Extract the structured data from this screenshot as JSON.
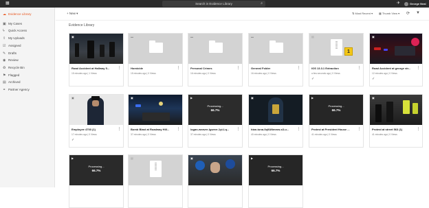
{
  "topbar": {
    "search_placeholder": "Search in Evidence Library",
    "user_name": "George Neal"
  },
  "sidebar": {
    "items": [
      {
        "label": "Evidence Library",
        "icon": "cloud-icon",
        "active": true
      },
      {
        "label": "My Cases",
        "icon": "briefcase-icon"
      },
      {
        "label": "Quick Access",
        "icon": "lightning-icon"
      },
      {
        "label": "My Uploads",
        "icon": "upload-icon"
      },
      {
        "label": "Assigned",
        "icon": "assigned-icon"
      },
      {
        "label": "Drafts",
        "icon": "draft-icon"
      },
      {
        "label": "Review",
        "icon": "review-icon"
      },
      {
        "label": "Recycle Bin",
        "icon": "trash-icon"
      },
      {
        "label": "Flagged",
        "icon": "flag-icon"
      },
      {
        "label": "Archived",
        "icon": "archive-icon"
      },
      {
        "label": "Partner Agency",
        "icon": "link-icon"
      }
    ]
  },
  "header": {
    "new_label": "New",
    "sort_label": "Most Recent",
    "view_label": "Thumb View"
  },
  "page_title": "Evidence Library",
  "cards": [
    {
      "name": "Road Accident at Hallway 5...",
      "meta": "15 minutes ago  |  1 Views",
      "type": "image"
    },
    {
      "name": "Homicide",
      "meta": "15 minutes ago  |  0 Views",
      "type": "folder"
    },
    {
      "name": "Personal Crimes",
      "meta": "16 minutes ago  |  0 Views",
      "type": "folder"
    },
    {
      "name": "General Folder",
      "meta": "16 minutes ago  |  0 Views",
      "type": "folder"
    },
    {
      "name": "IOS 13.3.1 Extraction",
      "meta": "a few seconds ago  |  0 Views",
      "type": "zip",
      "badge": "1",
      "check": true
    },
    {
      "name": "Road Accident at george str...",
      "meta": "12 minutes ago  |  0 Views",
      "type": "image",
      "check": true
    },
    {
      "name": "Employee 4703 (1)",
      "meta": "17 minutes ago  |  0 Views",
      "type": "image",
      "check": true
    },
    {
      "name": "Bomb Blast at Roadway Hill...",
      "meta": "37 minutes ago  |  0 Views",
      "type": "image"
    },
    {
      "name": "logan-weaver-lgwevr-1yt-Lq...",
      "meta": "37 minutes ago  |  0 Views",
      "type": "processing",
      "progress": "66.7%"
    },
    {
      "name": "hian-tuna-0q9ANmmw-s3-u...",
      "meta": "40 minutes ago  |  0 Views",
      "type": "image"
    },
    {
      "name": "Protest at President House ...",
      "meta": "41 minutes ago  |  0 Views",
      "type": "processing",
      "progress": "66.7%"
    },
    {
      "name": "Protest at street 563 (1)",
      "meta": "41 minutes ago  |  0 Views",
      "type": "image"
    },
    {
      "type": "processing",
      "progress": "66.7%"
    },
    {
      "type": "zip"
    },
    {
      "type": "image"
    },
    {
      "type": "processing",
      "progress": "66.7%"
    }
  ],
  "processing_label": "Processing...",
  "colors": {
    "accent": "#e8551e",
    "topbar": "#2b2b2b",
    "badge": "#f3c719"
  }
}
